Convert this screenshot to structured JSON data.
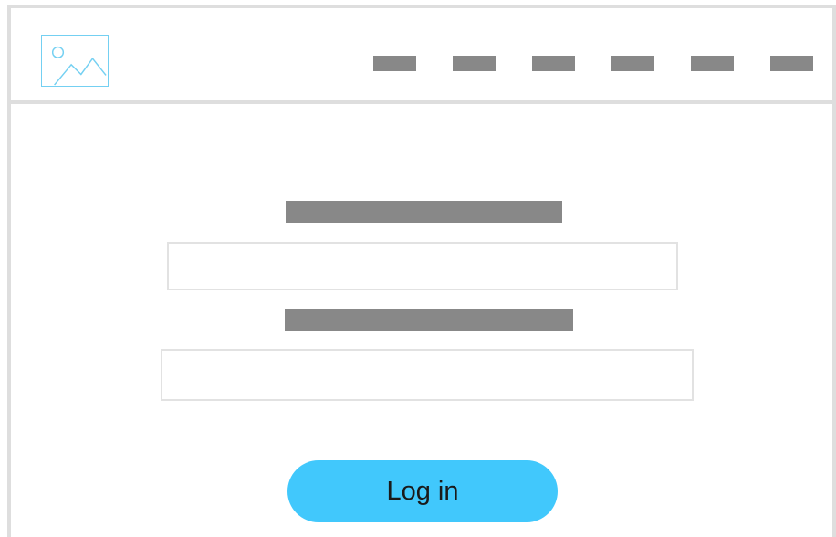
{
  "header": {
    "logo_icon": "image-placeholder-icon",
    "nav_items": [
      "",
      "",
      "",
      "",
      "",
      ""
    ]
  },
  "form": {
    "field_1": {
      "label": "",
      "value": "",
      "placeholder": ""
    },
    "field_2": {
      "label": "",
      "value": "",
      "placeholder": ""
    },
    "login_label": "Log in"
  },
  "colors": {
    "accent": "#41c8fc",
    "logo_stroke": "#74d0f2",
    "placeholder_bar": "#888888",
    "border": "#dedede"
  }
}
